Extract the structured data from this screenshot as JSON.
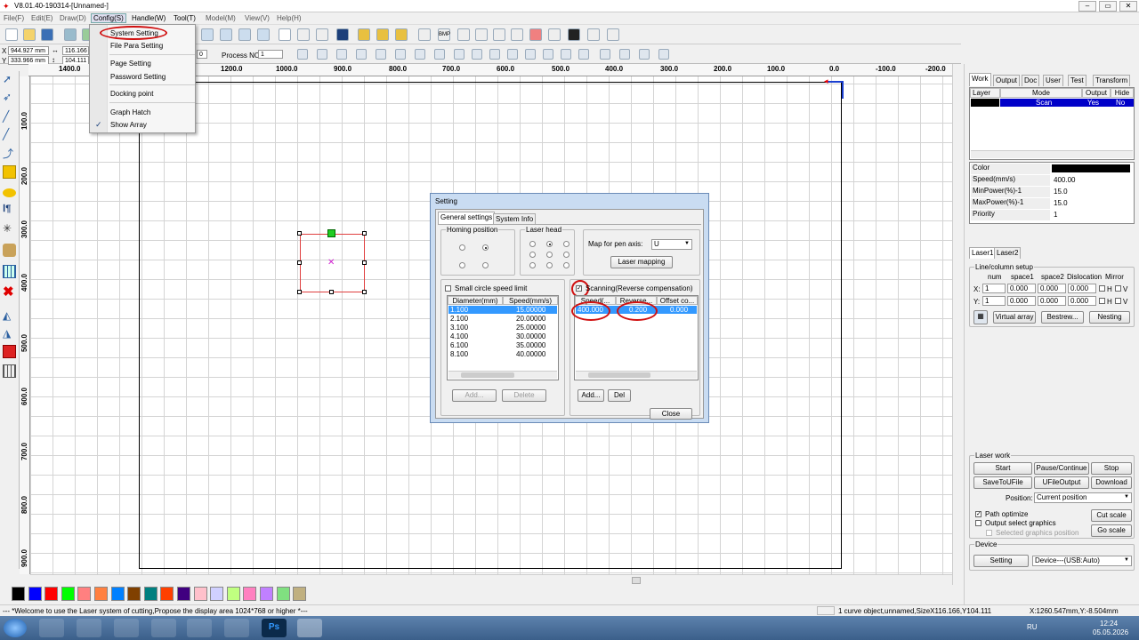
{
  "window": {
    "title": "V8.01.40-190314-[Unnamed-]"
  },
  "menu": [
    "File(F)",
    "Edit(E)",
    "Draw(D)",
    "Config(S)",
    "Handle(W)",
    "Tool(T)",
    "Model(M)",
    "View(V)",
    "Help(H)"
  ],
  "config_menu": {
    "items": [
      "System Setting",
      "File Para Setting",
      "Page Setting",
      "Password Setting",
      "Docking point",
      "Graph Hatch",
      "Show Array"
    ],
    "checked": "Show Array"
  },
  "toolbar2": {
    "x_label": "X",
    "y_label": "Y",
    "x_value": "944.927 mm",
    "y_value": "333.966 mm",
    "w_value": "116.166",
    "h_value": "104.111",
    "process_label": "Process NO:",
    "process_value": "1",
    "zero_value": "0"
  },
  "ruler_top": [
    "1400.0",
    "1200.0",
    "1000.0",
    "900.0",
    "800.0",
    "700.0",
    "600.0",
    "500.0",
    "400.0",
    "300.0",
    "200.0",
    "100.0",
    "0.0",
    "-100.0",
    "-200.0"
  ],
  "ruler_left": [
    "100.0",
    "200.0",
    "300.0",
    "400.0",
    "500.0",
    "600.0",
    "700.0",
    "800.0",
    "900.0"
  ],
  "palette_colors": [
    "#000000",
    "#0000ff",
    "#ff0000",
    "#00ff00",
    "#ff8080",
    "#ff8040",
    "#0080ff",
    "#804000",
    "#008080",
    "#ff4000",
    "#400080",
    "#ffc0cb",
    "#d0d0ff",
    "#c0ff80",
    "#ff80c0",
    "#c080ff",
    "#80e080",
    "#c0b080"
  ],
  "status": {
    "message": "--- *Welcome to use the Laser system of cutting,Propose the display area 1024*768 or higher *---",
    "object": "1 curve object,unnamed,SizeX116.166,Y104.111",
    "coords": "X:1260.547mm,Y:-8.504mm"
  },
  "taskbar": {
    "lang": "RU",
    "time": "12:24",
    "date": "05.05.2026"
  },
  "right_panel": {
    "tabs": [
      "Work",
      "Output",
      "Doc",
      "User",
      "Test",
      "Transform"
    ],
    "layer_headers": [
      "Layer",
      "Mode",
      "Output",
      "Hide"
    ],
    "layer_row": {
      "mode": "Scan",
      "output": "Yes",
      "hide": "No"
    },
    "props": [
      {
        "k": "Color",
        "v": ""
      },
      {
        "k": "Speed(mm/s)",
        "v": "400.00"
      },
      {
        "k": "MinPower(%)-1",
        "v": "15.0"
      },
      {
        "k": "MaxPower(%)-1",
        "v": "15.0"
      },
      {
        "k": "Priority",
        "v": "1"
      }
    ],
    "laser_tabs": [
      "Laser1",
      "Laser2"
    ],
    "array": {
      "title": "Line/column setup",
      "headers": [
        "num",
        "space1",
        "space2",
        "Dislocation",
        "Mirror"
      ],
      "x_label": "X:",
      "y_label": "Y:",
      "x": [
        "1",
        "0.000",
        "0.000",
        "0.000"
      ],
      "y": [
        "1",
        "0.000",
        "0.000",
        "0.000"
      ],
      "h": "H",
      "v": "V",
      "virtual_array": "Virtual array",
      "bestrew": "Bestrew...",
      "nesting": "Nesting"
    },
    "laser_work": {
      "title": "Laser work",
      "start": "Start",
      "pause": "Pause/Continue",
      "stop": "Stop",
      "save": "SaveToUFile",
      "ufile": "UFileOutput",
      "download": "Download",
      "position_label": "Position:",
      "position_value": "Current position",
      "path_optimize": "Path optimize",
      "output_select": "Output select graphics",
      "selected_pos": "Selected graphics position",
      "cut_scale": "Cut scale",
      "go_scale": "Go scale"
    },
    "device": {
      "title": "Device",
      "setting": "Setting",
      "value": "Device---(USB:Auto)"
    }
  },
  "dialog": {
    "title": "Setting",
    "tabs": [
      "General settings",
      "System Info"
    ],
    "homing_title": "Homing position",
    "laser_head_title": "Laser head",
    "map_label": "Map for pen axis:",
    "map_value": "U",
    "laser_mapping": "Laser mapping",
    "small_circle": "Small circle speed limit",
    "small_headers": [
      "Diameter(mm)",
      "Speed(mm/s)"
    ],
    "small_rows": [
      [
        "1.100",
        "15.00000"
      ],
      [
        "2.100",
        "20.00000"
      ],
      [
        "3.100",
        "25.00000"
      ],
      [
        "4.100",
        "30.00000"
      ],
      [
        "6.100",
        "35.00000"
      ],
      [
        "8.100",
        "40.00000"
      ]
    ],
    "add": "Add...",
    "delete": "Delete",
    "scanning": "Scanning(Reverse compensation)",
    "scan_headers": [
      "Speed(...",
      "Reverse...",
      "Offset co..."
    ],
    "scan_row": [
      "400.000",
      "0.200",
      "0.000"
    ],
    "add2": "Add...",
    "del": "Del",
    "close": "Close"
  }
}
